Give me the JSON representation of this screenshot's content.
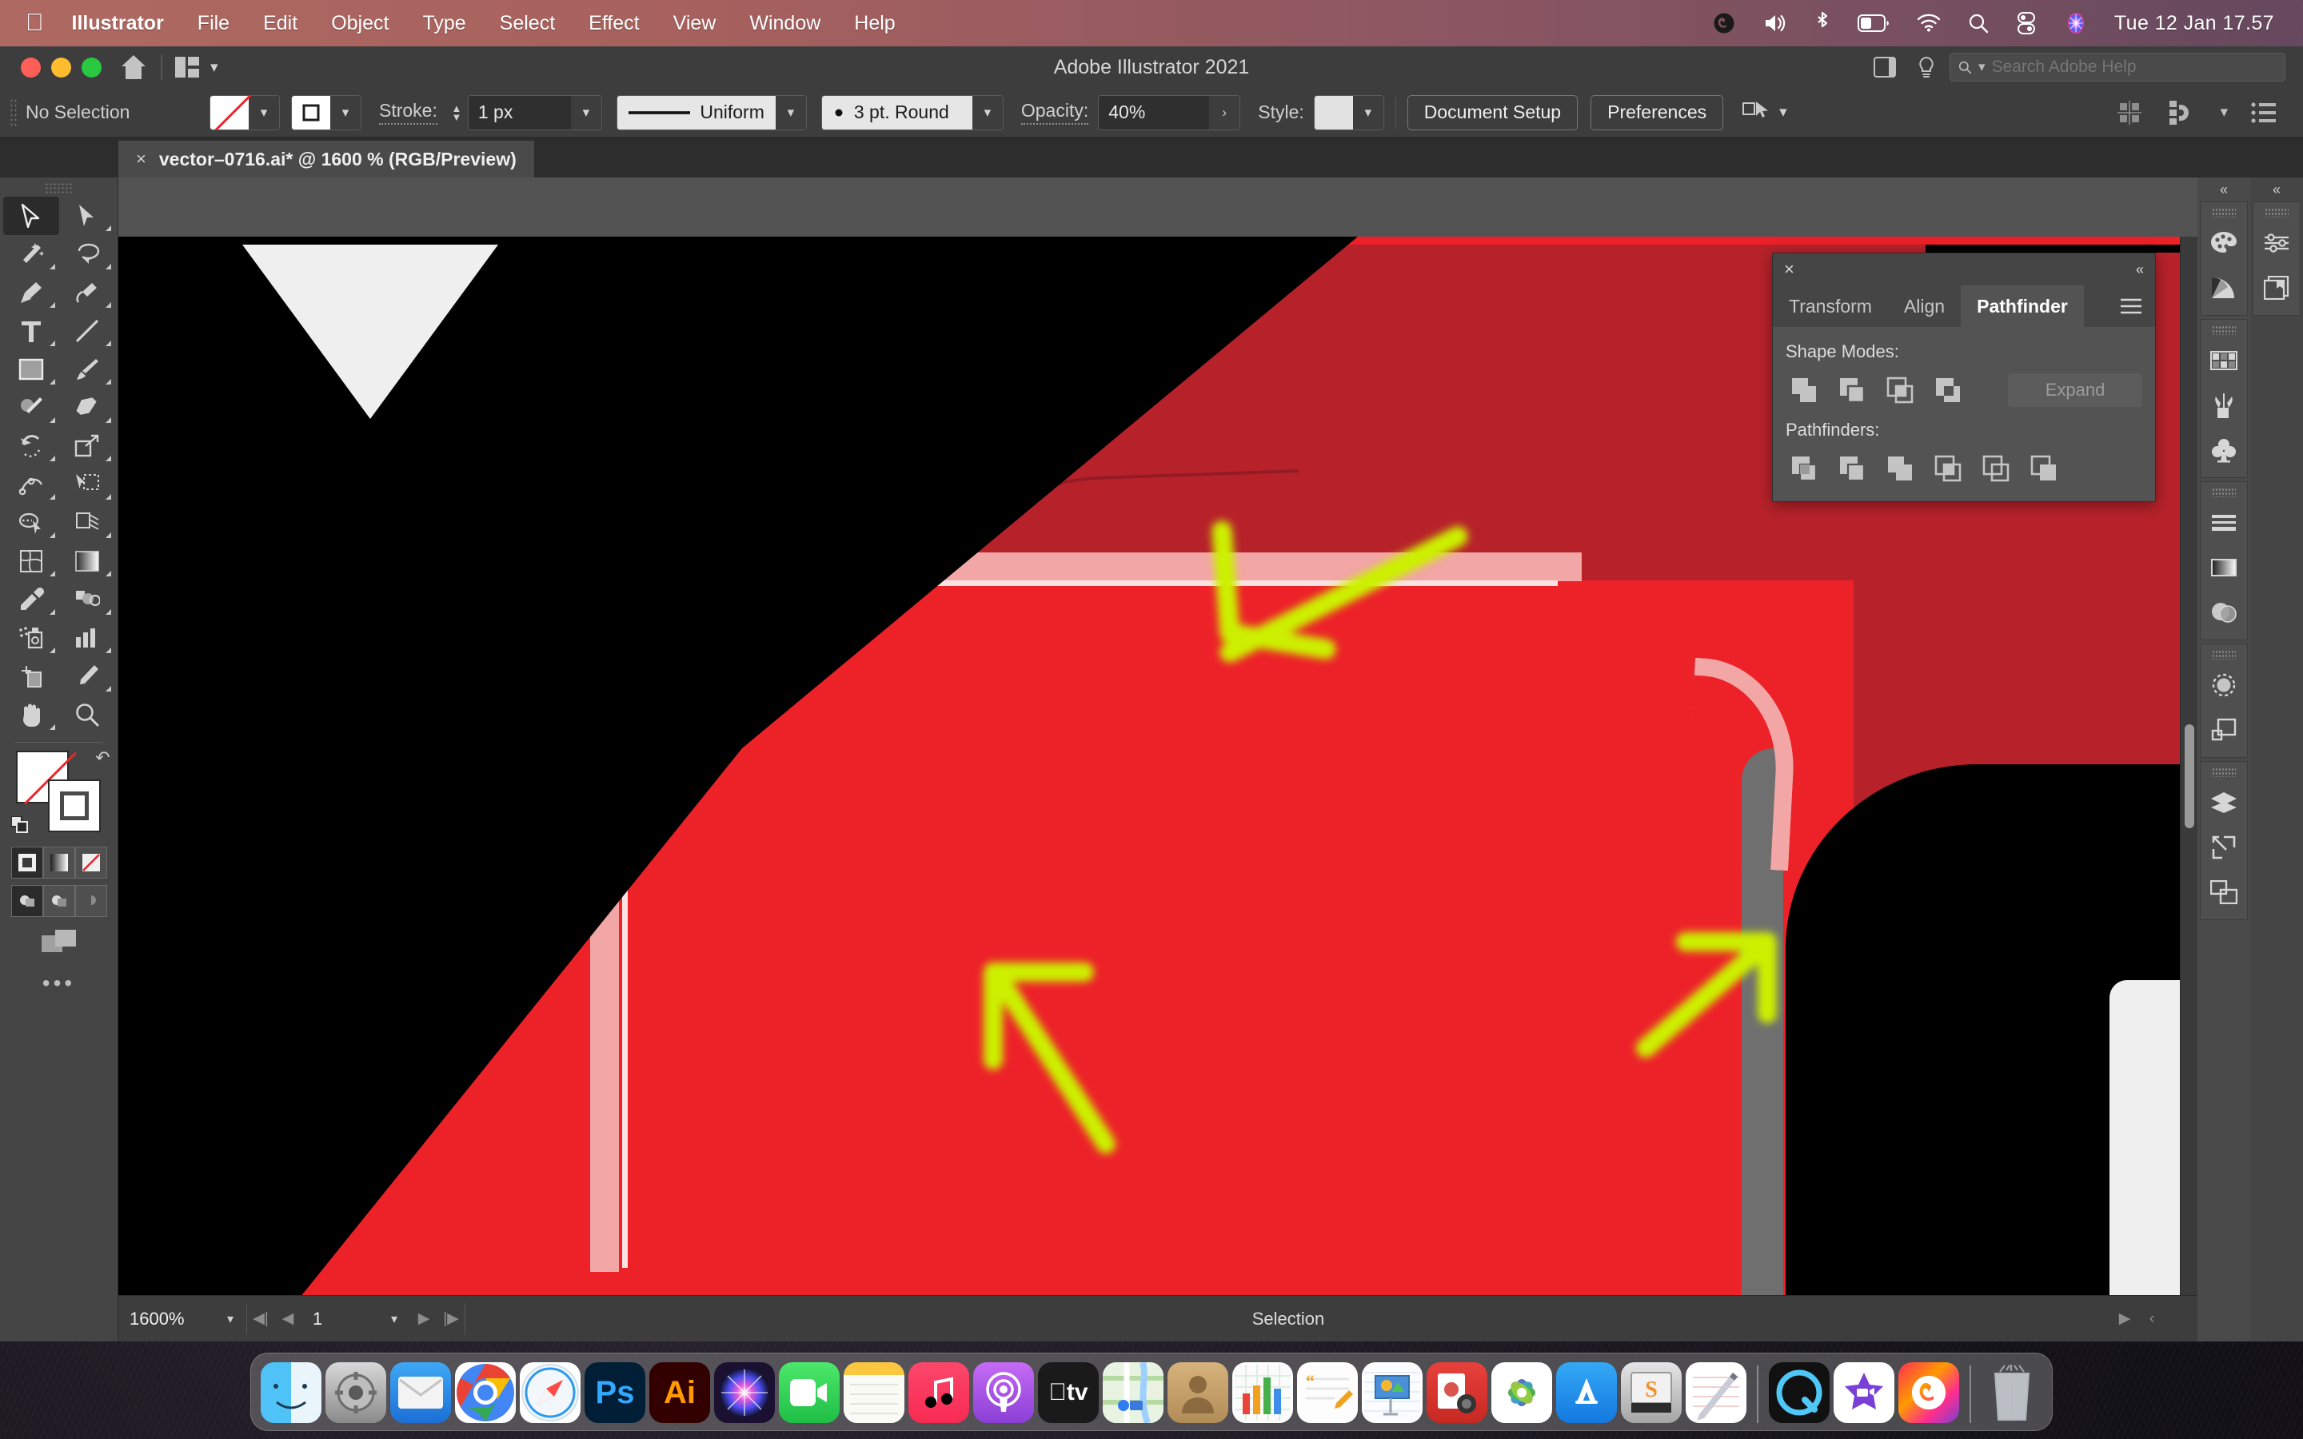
{
  "menubar": {
    "apple": "apple-logo",
    "items": [
      {
        "label": "Illustrator",
        "bold": true
      },
      {
        "label": "File",
        "bold": false
      },
      {
        "label": "Edit",
        "bold": false
      },
      {
        "label": "Object",
        "bold": false
      },
      {
        "label": "Type",
        "bold": false
      },
      {
        "label": "Select",
        "bold": false
      },
      {
        "label": "Effect",
        "bold": false
      },
      {
        "label": "View",
        "bold": false
      },
      {
        "label": "Window",
        "bold": false
      },
      {
        "label": "Help",
        "bold": false
      }
    ],
    "status_icons": [
      "creative-cloud-icon",
      "volume-icon",
      "bluetooth-icon",
      "battery-icon",
      "wifi-icon",
      "spotlight-search-icon",
      "control-center-icon",
      "siri-icon"
    ],
    "clock": "Tue 12 Jan  17.57"
  },
  "window": {
    "title": "Adobe Illustrator 2021",
    "home_icon": "home-icon",
    "arrange_icon": "arrange-documents-icon",
    "layout_icon": "switch-layout-icon",
    "help_icon": "help-bulb-icon",
    "search_placeholder": "Search Adobe Help",
    "search_value": ""
  },
  "controlbar": {
    "selection_state": "No Selection",
    "fill_label": "fill-none-swatch",
    "stroke_label": "stroke-swatch",
    "stroke_title": "Stroke:",
    "stroke_weight": "1 px",
    "profile": "Uniform",
    "brush": "3 pt. Round",
    "opacity_title": "Opacity:",
    "opacity_value": "40%",
    "style_title": "Style:",
    "document_setup": "Document Setup",
    "preferences": "Preferences",
    "select_similar_icon": "select-similar-objects-icon",
    "align_icon": "align-to-artboard-icon",
    "snap_icon": "snap-to-glyph-icon",
    "options_icon": "more-options-icon"
  },
  "tab": {
    "close": "×",
    "title": "vector–0716.ai* @ 1600 % (RGB/Preview)"
  },
  "tools": {
    "column_left": [
      {
        "name": "selection-tool",
        "active": true
      },
      {
        "name": "magic-wand-tool",
        "active": false
      },
      {
        "name": "pen-tool",
        "active": false
      },
      {
        "name": "type-tool",
        "active": false
      },
      {
        "name": "rectangle-tool",
        "active": false
      },
      {
        "name": "shaper-tool",
        "active": false
      },
      {
        "name": "rotate-tool",
        "active": false
      },
      {
        "name": "width-tool",
        "active": false
      },
      {
        "name": "shape-builder-tool",
        "active": false
      },
      {
        "name": "mesh-tool",
        "active": false
      },
      {
        "name": "eyedropper-tool",
        "active": false
      },
      {
        "name": "symbol-sprayer-tool",
        "active": false
      },
      {
        "name": "artboard-tool",
        "active": false
      },
      {
        "name": "hand-tool",
        "active": false
      }
    ],
    "column_right": [
      {
        "name": "direct-selection-tool",
        "active": false
      },
      {
        "name": "lasso-tool",
        "active": false
      },
      {
        "name": "curvature-tool",
        "active": false
      },
      {
        "name": "line-segment-tool",
        "active": false
      },
      {
        "name": "paintbrush-tool",
        "active": false
      },
      {
        "name": "eraser-tool",
        "active": false
      },
      {
        "name": "scale-tool",
        "active": false
      },
      {
        "name": "free-transform-tool",
        "active": false
      },
      {
        "name": "perspective-grid-tool",
        "active": false
      },
      {
        "name": "gradient-tool",
        "active": false
      },
      {
        "name": "blend-tool",
        "active": false
      },
      {
        "name": "column-graph-tool",
        "active": false
      },
      {
        "name": "slice-tool",
        "active": false
      },
      {
        "name": "zoom-tool",
        "active": false
      }
    ],
    "fill_stroke": {
      "fill": "none-fill-swatch",
      "stroke": "stroke-swatch",
      "swap_icon": "swap-fill-stroke-icon",
      "default_icon": "default-fill-stroke-icon"
    },
    "color_modes": [
      {
        "name": "color-mode-button",
        "on": true
      },
      {
        "name": "gradient-mode-button",
        "on": false
      },
      {
        "name": "none-mode-button",
        "on": false
      }
    ],
    "draw_modes": [
      {
        "name": "draw-normal-button",
        "on": true
      },
      {
        "name": "draw-behind-button",
        "on": false
      },
      {
        "name": "draw-inside-button",
        "on": false
      }
    ],
    "screen_mode": "change-screen-mode-icon",
    "more": "•••"
  },
  "pathfinder": {
    "close": "×",
    "collapse": "«",
    "tabs": [
      {
        "label": "Transform",
        "active": false
      },
      {
        "label": "Align",
        "active": false
      },
      {
        "label": "Pathfinder",
        "active": true
      }
    ],
    "menu_icon": "panel-menu-icon",
    "shape_modes_title": "Shape Modes:",
    "shape_modes": [
      "unite-button",
      "minus-front-button",
      "intersect-button",
      "exclude-button"
    ],
    "expand_label": "Expand",
    "pathfinders_title": "Pathfinders:",
    "pathfinders": [
      "divide-button",
      "trim-button",
      "merge-button",
      "crop-button",
      "outline-button",
      "minus-back-button"
    ]
  },
  "rightdock": {
    "collapse_a": "«",
    "collapse_b": "«",
    "column_a": [
      {
        "icons": [
          "color-panel-icon",
          "color-guide-panel-icon"
        ]
      },
      {
        "icons": [
          "swatches-panel-icon",
          "brushes-panel-icon",
          "symbols-panel-icon"
        ]
      },
      {
        "icons": [
          "stroke-panel-icon",
          "gradient-panel-icon",
          "transparency-panel-icon"
        ]
      },
      {
        "icons": [
          "appearance-panel-icon",
          "graphic-styles-panel-icon"
        ]
      },
      {
        "icons": [
          "layers-panel-icon",
          "asset-export-panel-icon",
          "artboards-panel-icon"
        ]
      }
    ],
    "column_b": [
      {
        "icons": [
          "properties-panel-icon",
          "libraries-panel-icon"
        ]
      }
    ]
  },
  "statusbar": {
    "zoom": "1600%",
    "zoom_chevron": "chevron-down-icon",
    "first_artboard": "first-artboard-icon",
    "prev_artboard": "previous-artboard-icon",
    "artboard_number": "1",
    "artboard_chevron": "chevron-down-icon",
    "next_artboard": "next-artboard-icon",
    "last_artboard": "last-artboard-icon",
    "status_text": "Selection",
    "status_arrow": "status-menu-arrow-icon",
    "resize_arrow": "panel-expand-icon"
  },
  "canvas": {
    "zoom_level": "1600 %",
    "color_mode": "RGB/Preview",
    "colors": {
      "background_black": "#000000",
      "bright_red": "#ed2229",
      "dark_red": "#b7222a",
      "light_highlight": "#f2a6a6",
      "white_shape": "#efefef",
      "grey_shadow": "#6f6f6f",
      "annotation_yellow": "#ccf000"
    },
    "annotations": [
      {
        "name": "annotation-arrow-top",
        "direction": "down-left"
      },
      {
        "name": "annotation-arrow-middle-left",
        "direction": "up-left"
      },
      {
        "name": "annotation-arrow-middle-right",
        "direction": "up-right"
      }
    ]
  },
  "macdock": {
    "apps": [
      {
        "name": "finder",
        "label": "",
        "running": true
      },
      {
        "name": "system-preferences",
        "label": "",
        "running": false
      },
      {
        "name": "mail",
        "label": "",
        "running": false
      },
      {
        "name": "google-chrome",
        "label": "",
        "running": true
      },
      {
        "name": "safari",
        "label": "",
        "running": true
      },
      {
        "name": "photoshop",
        "label": "Ps",
        "running": true
      },
      {
        "name": "illustrator",
        "label": "Ai",
        "running": true
      },
      {
        "name": "siri",
        "label": "",
        "running": false
      },
      {
        "name": "facetime",
        "label": "",
        "running": false
      },
      {
        "name": "notes",
        "label": "",
        "running": false
      },
      {
        "name": "music",
        "label": "",
        "running": false
      },
      {
        "name": "podcasts",
        "label": "",
        "running": false
      },
      {
        "name": "apple-tv",
        "label": "",
        "running": false
      },
      {
        "name": "maps",
        "label": "",
        "running": false
      },
      {
        "name": "contacts",
        "label": "",
        "running": false
      },
      {
        "name": "numbers",
        "label": "",
        "running": false
      },
      {
        "name": "pages",
        "label": "",
        "running": false
      },
      {
        "name": "keynote",
        "label": "",
        "running": false
      },
      {
        "name": "photo-booth",
        "label": "",
        "running": false
      },
      {
        "name": "photos",
        "label": "",
        "running": false
      },
      {
        "name": "app-store",
        "label": "",
        "running": false
      },
      {
        "name": "stickies",
        "label": "S",
        "running": false
      },
      {
        "name": "textedit",
        "label": "",
        "running": false
      },
      {
        "name": "quicktime-player",
        "label": "",
        "running": false
      },
      {
        "name": "imovie",
        "label": "",
        "running": false
      },
      {
        "name": "creative-cloud",
        "label": "",
        "running": true
      }
    ],
    "trash": {
      "name": "trash",
      "label": ""
    }
  }
}
